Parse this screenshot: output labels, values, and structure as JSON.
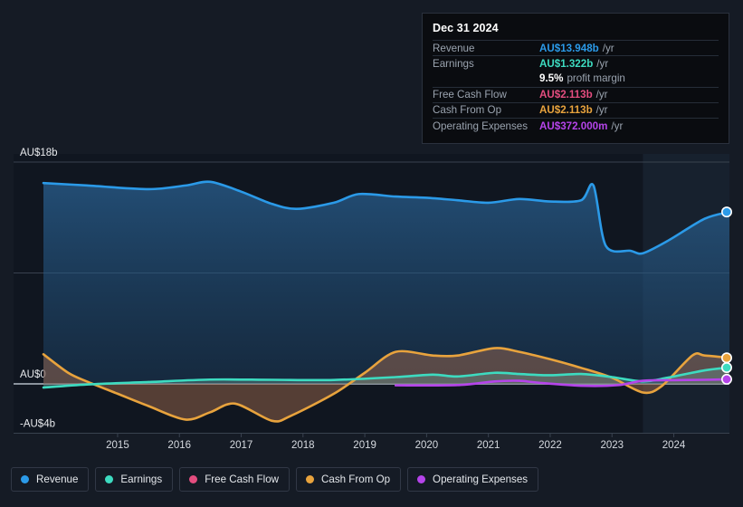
{
  "tooltip": {
    "date": "Dec 31 2024",
    "rows": [
      {
        "label": "Revenue",
        "value": "AU$13.948b",
        "suffix": "/yr",
        "color": "#2b9ae8"
      },
      {
        "label": "Earnings",
        "value": "AU$1.322b",
        "suffix": "/yr",
        "color": "#3ddbc0"
      },
      {
        "label": "",
        "value": "9.5%",
        "suffix": "profit margin",
        "color": "#ffffff"
      },
      {
        "label": "Free Cash Flow",
        "value": "AU$2.113b",
        "suffix": "/yr",
        "color": "#e44d7f"
      },
      {
        "label": "Cash From Op",
        "value": "AU$2.113b",
        "suffix": "/yr",
        "color": "#e8a33d"
      },
      {
        "label": "Operating Expenses",
        "value": "AU$372.000m",
        "suffix": "/yr",
        "color": "#b544ea"
      }
    ]
  },
  "legend": {
    "items": [
      {
        "label": "Revenue",
        "color": "#2b9ae8"
      },
      {
        "label": "Earnings",
        "color": "#3ddbc0"
      },
      {
        "label": "Free Cash Flow",
        "color": "#e44d7f"
      },
      {
        "label": "Cash From Op",
        "color": "#e8a33d"
      },
      {
        "label": "Operating Expenses",
        "color": "#b544ea"
      }
    ]
  },
  "chart_data": {
    "type": "area",
    "title": "",
    "xlabel": "",
    "ylabel": "",
    "currency": "AU$",
    "grid": true,
    "legend_position": "bottom",
    "ylim": [
      -4,
      18
    ],
    "y_ticks": [
      {
        "value": 18,
        "label": "AU$18b"
      },
      {
        "value": 9,
        "label": ""
      },
      {
        "value": 0,
        "label": "AU$0"
      },
      {
        "value": -4,
        "label": "-AU$4b"
      }
    ],
    "x_ticks": [
      "2015",
      "2016",
      "2017",
      "2018",
      "2019",
      "2020",
      "2021",
      "2022",
      "2023",
      "2024"
    ],
    "x_range": [
      2014.3,
      2025.4
    ],
    "forecast_start": 2024.0,
    "series": [
      {
        "name": "Revenue",
        "color": "#2b9ae8",
        "fill": "rgba(36,110,175,0.40)",
        "points": [
          [
            2014.3,
            16.3
          ],
          [
            2015.0,
            16.1
          ],
          [
            2016.0,
            15.8
          ],
          [
            2016.6,
            16.1
          ],
          [
            2017.0,
            16.4
          ],
          [
            2017.5,
            15.6
          ],
          [
            2018.0,
            14.6
          ],
          [
            2018.4,
            14.2
          ],
          [
            2019.0,
            14.7
          ],
          [
            2019.4,
            15.4
          ],
          [
            2020.0,
            15.2
          ],
          [
            2020.5,
            15.1
          ],
          [
            2021.0,
            14.9
          ],
          [
            2021.5,
            14.7
          ],
          [
            2022.0,
            15.0
          ],
          [
            2022.5,
            14.8
          ],
          [
            2023.0,
            14.9
          ],
          [
            2023.2,
            16.1
          ],
          [
            2023.4,
            11.2
          ],
          [
            2023.8,
            10.8
          ],
          [
            2024.0,
            10.6
          ],
          [
            2024.4,
            11.6
          ],
          [
            2025.0,
            13.4
          ],
          [
            2025.4,
            13.948
          ]
        ]
      },
      {
        "name": "Cash From Op",
        "color": "#e8a33d",
        "fill": "rgba(170,110,80,0.45)",
        "points": [
          [
            2014.3,
            2.4
          ],
          [
            2014.7,
            0.9
          ],
          [
            2015.0,
            0.2
          ],
          [
            2015.5,
            -0.8
          ],
          [
            2016.0,
            -1.8
          ],
          [
            2016.6,
            -2.9
          ],
          [
            2017.0,
            -2.3
          ],
          [
            2017.4,
            -1.6
          ],
          [
            2018.0,
            -3.0
          ],
          [
            2018.3,
            -2.6
          ],
          [
            2019.0,
            -0.8
          ],
          [
            2019.5,
            0.9
          ],
          [
            2020.0,
            2.6
          ],
          [
            2020.6,
            2.3
          ],
          [
            2021.0,
            2.3
          ],
          [
            2021.6,
            2.9
          ],
          [
            2022.0,
            2.6
          ],
          [
            2022.5,
            2.0
          ],
          [
            2023.0,
            1.3
          ],
          [
            2023.5,
            0.5
          ],
          [
            2024.0,
            -0.7
          ],
          [
            2024.3,
            -0.2
          ],
          [
            2024.8,
            2.3
          ],
          [
            2025.0,
            2.3
          ],
          [
            2025.4,
            2.113
          ]
        ]
      },
      {
        "name": "Earnings",
        "color": "#3ddbc0",
        "fill": "rgba(100,140,135,0.45)",
        "points": [
          [
            2014.3,
            -0.3
          ],
          [
            2015.0,
            -0.05
          ],
          [
            2016.0,
            0.15
          ],
          [
            2017.0,
            0.35
          ],
          [
            2018.0,
            0.33
          ],
          [
            2019.0,
            0.32
          ],
          [
            2020.0,
            0.55
          ],
          [
            2020.6,
            0.75
          ],
          [
            2021.0,
            0.6
          ],
          [
            2021.6,
            0.9
          ],
          [
            2022.0,
            0.8
          ],
          [
            2022.5,
            0.7
          ],
          [
            2023.0,
            0.8
          ],
          [
            2023.5,
            0.55
          ],
          [
            2024.0,
            0.2
          ],
          [
            2024.4,
            0.5
          ],
          [
            2025.0,
            1.1
          ],
          [
            2025.4,
            1.322
          ]
        ]
      },
      {
        "name": "Operating Expenses",
        "color": "#b544ea",
        "fill": "none",
        "points": [
          [
            2020.0,
            -0.12
          ],
          [
            2021.0,
            -0.1
          ],
          [
            2021.6,
            0.2
          ],
          [
            2022.0,
            0.25
          ],
          [
            2022.3,
            0.1
          ],
          [
            2023.0,
            -0.15
          ],
          [
            2023.6,
            -0.1
          ],
          [
            2024.0,
            0.25
          ],
          [
            2024.5,
            0.3
          ],
          [
            2025.0,
            0.33
          ],
          [
            2025.4,
            0.372
          ]
        ]
      },
      {
        "name": "Free Cash Flow",
        "color": "#e44d7f",
        "fill": "none",
        "points": []
      }
    ],
    "endpoints": [
      {
        "name": "Revenue",
        "value": 13.948,
        "color": "#2b9ae8"
      },
      {
        "name": "Cash From Op",
        "value": 2.113,
        "color": "#e8a33d"
      },
      {
        "name": "Earnings",
        "value": 1.322,
        "color": "#3ddbc0"
      },
      {
        "name": "Operating Expenses",
        "value": 0.372,
        "color": "#b544ea"
      }
    ]
  }
}
